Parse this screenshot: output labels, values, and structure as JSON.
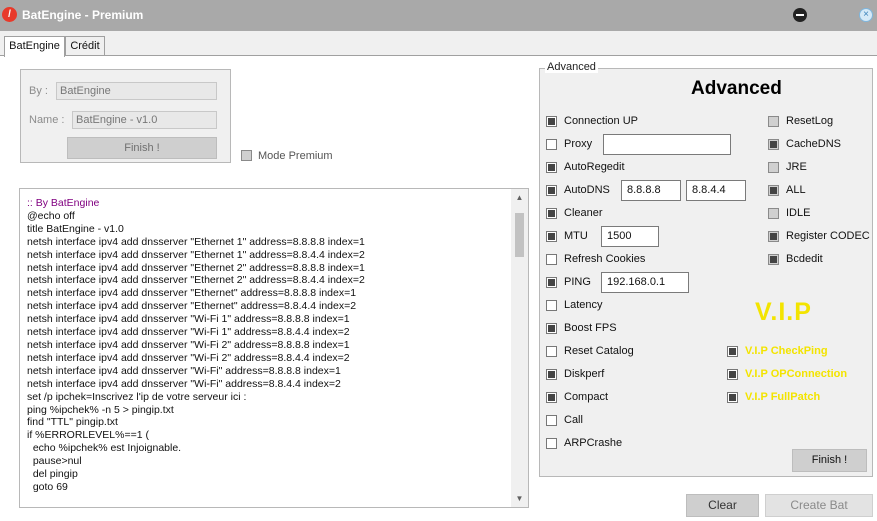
{
  "window": {
    "title": "BatEngine - Premium",
    "app_glyph": "/",
    "close_glyph": "×"
  },
  "tabs": [
    {
      "label": "BatEngine",
      "active": true
    },
    {
      "label": "Crédit",
      "active": false
    }
  ],
  "identity": {
    "by_label": "By :",
    "by_value": "BatEngine",
    "name_label": "Name :",
    "name_value": "BatEngine - v1.0",
    "finish_label": "Finish !"
  },
  "mode_premium": {
    "label": "Mode Premium",
    "checked": false
  },
  "script": {
    "lines": [
      ":: By BatEngine",
      "@echo off",
      "title BatEngine - v1.0",
      "netsh interface ipv4 add dnsserver \"Ethernet 1\" address=8.8.8.8 index=1",
      "netsh interface ipv4 add dnsserver \"Ethernet 1\" address=8.8.4.4 index=2",
      "netsh interface ipv4 add dnsserver \"Ethernet 2\" address=8.8.8.8 index=1",
      "netsh interface ipv4 add dnsserver \"Ethernet 2\" address=8.8.4.4 index=2",
      "netsh interface ipv4 add dnsserver \"Ethernet\" address=8.8.8.8 index=1",
      "netsh interface ipv4 add dnsserver \"Ethernet\" address=8.8.4.4 index=2",
      "netsh interface ipv4 add dnsserver \"Wi-Fi 1\" address=8.8.8.8 index=1",
      "netsh interface ipv4 add dnsserver \"Wi-Fi 1\" address=8.8.4.4 index=2",
      "netsh interface ipv4 add dnsserver \"Wi-Fi 2\" address=8.8.8.8 index=1",
      "netsh interface ipv4 add dnsserver \"Wi-Fi 2\" address=8.8.4.4 index=2",
      "netsh interface ipv4 add dnsserver \"Wi-Fi\" address=8.8.8.8 index=1",
      "netsh interface ipv4 add dnsserver \"Wi-Fi\" address=8.8.4.4 index=2",
      "set /p ipchek=Inscrivez l'ip de votre serveur ici :",
      "",
      "ping %ipchek% -n 5 > pingip.txt",
      "find \"TTL\" pingip.txt",
      "if %ERRORLEVEL%==1 (",
      "  echo %ipchek% est Injoignable.",
      "  pause>nul",
      "  del pingip",
      "  goto 69"
    ],
    "comment_color": "#800080"
  },
  "advanced": {
    "legend": "Advanced",
    "heading": "Advanced",
    "left_options": [
      {
        "label": "Connection UP",
        "checked": true
      },
      {
        "label": "Proxy",
        "checked": false,
        "value": ""
      },
      {
        "label": "AutoRegedit",
        "checked": true
      },
      {
        "label": "AutoDNS",
        "checked": true,
        "dns1": "8.8.8.8",
        "dns2": "8.8.4.4"
      },
      {
        "label": "Cleaner",
        "checked": true
      },
      {
        "label": "MTU",
        "checked": true,
        "value": "1500"
      },
      {
        "label": "Refresh Cookies",
        "checked": false
      },
      {
        "label": "PING",
        "checked": true,
        "value": "192.168.0.1"
      },
      {
        "label": "Latency",
        "checked": false
      },
      {
        "label": "Boost FPS",
        "checked": true
      },
      {
        "label": "Reset Catalog",
        "checked": false
      },
      {
        "label": "Diskperf",
        "checked": true
      },
      {
        "label": "Compact",
        "checked": true
      },
      {
        "label": "Call",
        "checked": false
      },
      {
        "label": "ARPCrashe",
        "checked": false
      }
    ],
    "right_options": [
      {
        "label": "ResetLog",
        "checked": false
      },
      {
        "label": "CacheDNS",
        "checked": true
      },
      {
        "label": "JRE",
        "checked": false
      },
      {
        "label": "ALL",
        "checked": true
      },
      {
        "label": "IDLE",
        "checked": false
      },
      {
        "label": "Register CODEC",
        "checked": true
      },
      {
        "label": "Bcdedit",
        "checked": true
      }
    ],
    "vip": {
      "title": "V.I.P",
      "color": "#f3e400",
      "options": [
        {
          "label": "V.I.P CheckPing",
          "checked": true
        },
        {
          "label": "V.I.P OPConnection",
          "checked": true
        },
        {
          "label": "V.I.P FullPatch",
          "checked": true
        }
      ]
    },
    "finish_label": "Finish !"
  },
  "footer": {
    "clear_label": "Clear",
    "create_label": "Create Bat"
  }
}
